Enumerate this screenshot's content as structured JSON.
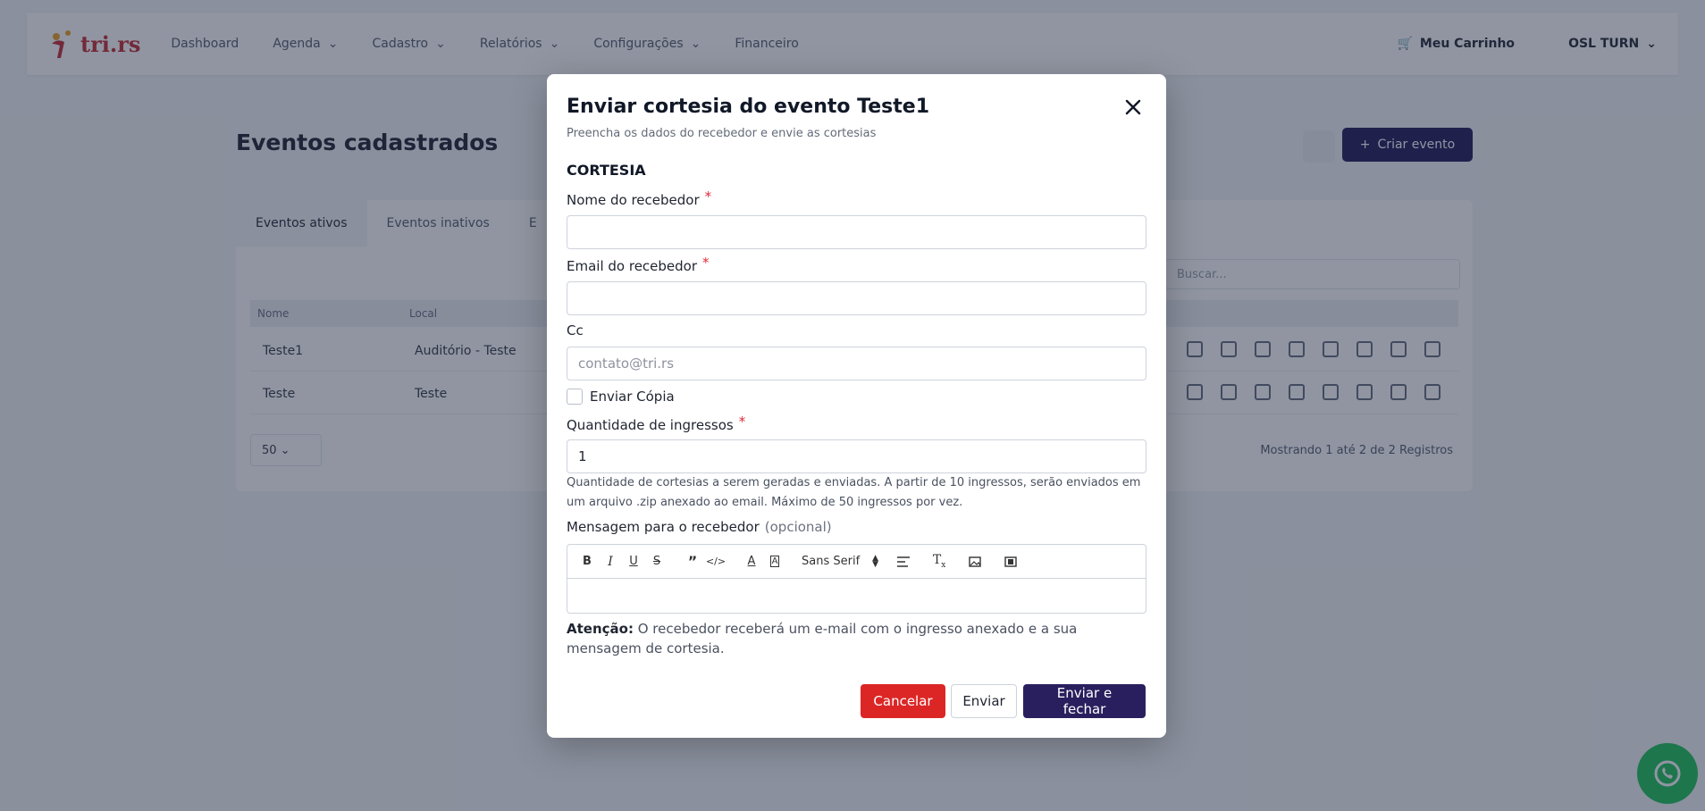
{
  "nav": {
    "logo_text": "tri.rs",
    "items": [
      {
        "label": "Dashboard",
        "has_chevron": false
      },
      {
        "label": "Agenda",
        "has_chevron": true
      },
      {
        "label": "Cadastro",
        "has_chevron": true
      },
      {
        "label": "Relatórios",
        "has_chevron": true
      },
      {
        "label": "Configurações",
        "has_chevron": true
      },
      {
        "label": "Financeiro",
        "has_chevron": false
      }
    ],
    "cart_label": "Meu Carrinho",
    "user_label": "OSL TURN"
  },
  "page": {
    "title": "Eventos cadastrados",
    "create_button": "Criar evento",
    "tabs": [
      "Eventos ativos",
      "Eventos inativos",
      "E"
    ],
    "search_placeholder": "Buscar...",
    "table": {
      "headers": [
        "Nome",
        "Local"
      ],
      "rows": [
        {
          "name": "Teste1",
          "local": "Auditório - Teste"
        },
        {
          "name": "Teste",
          "local": "Teste"
        }
      ]
    },
    "per_page": "50",
    "showing": "Mostrando 1 até 2 de 2 Registros"
  },
  "modal": {
    "title": "Enviar cortesia do evento Teste1",
    "subtitle": "Preencha os dados do recebedor e envie as cortesias",
    "section": "CORTESIA",
    "fields": {
      "name": {
        "label": "Nome do recebedor",
        "required_mark": "*",
        "value": ""
      },
      "email": {
        "label": "Email do recebedor",
        "required_mark": "*",
        "value": ""
      },
      "cc": {
        "label": "Cc",
        "placeholder": "contato@tri.rs",
        "value": ""
      },
      "send_copy": {
        "label": "Enviar Cópia",
        "checked": false
      },
      "quantity": {
        "label": "Quantidade de ingressos",
        "required_mark": "*",
        "value": "1",
        "help": "Quantidade de cortesias a serem geradas e enviadas. A partir de 10 ingressos, serão enviados em um arquivo .zip anexado ao email. Máximo de 50 ingressos por vez."
      },
      "message": {
        "label": "Mensagem para o recebedor",
        "optional": "(opcional)",
        "font_select": "Sans Serif"
      }
    },
    "attention_label": "Atenção:",
    "attention_text": "O recebedor receberá um e-mail com o ingresso anexado e a sua mensagem de cortesia.",
    "buttons": {
      "cancel": "Cancelar",
      "send": "Enviar",
      "send_close": "Enviar e fechar"
    }
  },
  "colors": {
    "primary": "#2a1f5e",
    "danger": "#dc2626",
    "required": "#e0293a",
    "whatsapp": "#25c35f"
  }
}
